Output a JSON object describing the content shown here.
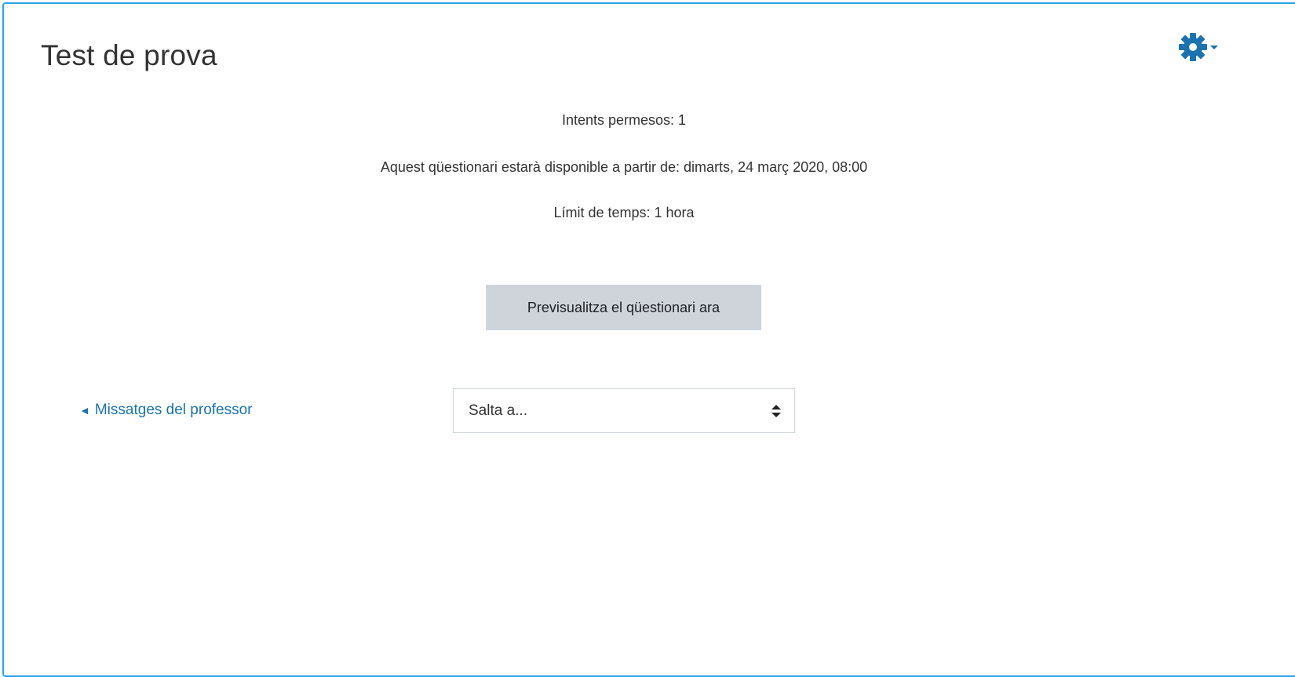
{
  "page": {
    "title": "Test de prova"
  },
  "quiz_info": {
    "attempts": "Intents permesos: 1",
    "available_from": "Aquest qüestionari estarà disponible a partir de: dimarts, 24 març 2020, 08:00",
    "time_limit": "Límit de temps: 1 hora"
  },
  "actions": {
    "preview_label": "Previsualitza el qüestionari ara"
  },
  "navigation": {
    "previous_link": "Missatges del professor",
    "previous_arrow": "◄",
    "jump_select_value": "Salta a..."
  },
  "icons": {
    "settings": "gear-icon",
    "settings_dropdown": "caret-down-icon",
    "select_caret": "sort-icon"
  },
  "colors": {
    "accent": "#1a73b0",
    "frame": "#29a3e6",
    "button_bg": "#ced4da"
  }
}
